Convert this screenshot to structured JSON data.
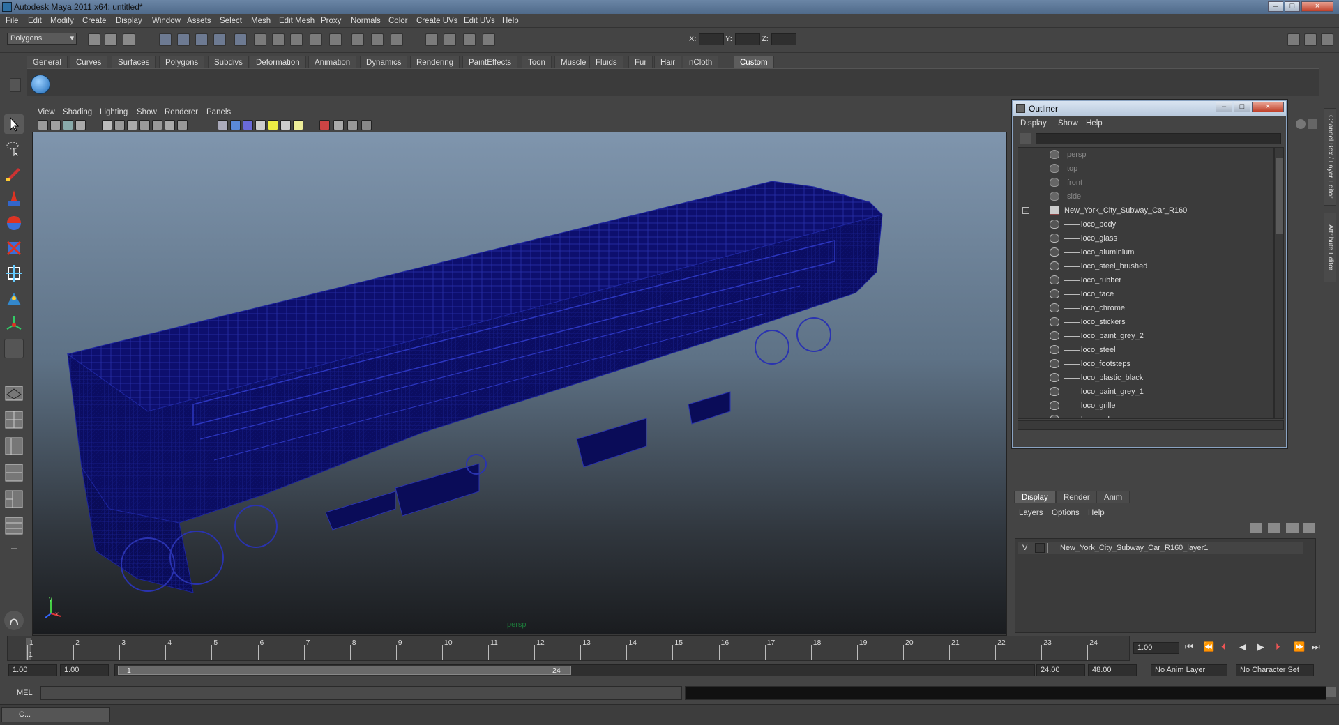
{
  "window": {
    "title": "Autodesk Maya 2011 x64: untitled*",
    "min": "–",
    "max": "□",
    "close": "×"
  },
  "menubar": [
    "File",
    "Edit",
    "Modify",
    "Create",
    "Display",
    "Window",
    "Assets",
    "Select",
    "Mesh",
    "Edit Mesh",
    "Proxy",
    "Normals",
    "Color",
    "Create UVs",
    "Edit UVs",
    "Help"
  ],
  "status": {
    "mode": "Polygons",
    "x_label": "X:",
    "y_label": "Y:",
    "z_label": "Z:"
  },
  "shelf_tabs": [
    "General",
    "Curves",
    "Surfaces",
    "Polygons",
    "Subdivs",
    "Deformation",
    "Animation",
    "Dynamics",
    "Rendering",
    "PaintEffects",
    "Toon",
    "Muscle",
    "Fluids",
    "Fur",
    "Hair",
    "nCloth",
    "Custom"
  ],
  "shelf_active": "Custom",
  "viewport": {
    "menu": [
      "View",
      "Shading",
      "Lighting",
      "Show",
      "Renderer",
      "Panels"
    ],
    "camera_label": "persp",
    "axis_x": "x",
    "axis_y": "y"
  },
  "outliner": {
    "title": "Outliner",
    "menu": [
      "Display",
      "Show",
      "Help"
    ],
    "cameras": [
      "persp",
      "top",
      "front",
      "side"
    ],
    "group": "New_York_City_Subway_Car_R160",
    "children": [
      "loco_body",
      "loco_glass",
      "loco_aluminium",
      "loco_steel_brushed",
      "loco_rubber",
      "loco_face",
      "loco_chrome",
      "loco_stickers",
      "loco_paint_grey_2",
      "loco_steel",
      "loco_footsteps",
      "loco_plastic_black",
      "loco_paint_grey_1",
      "loco_grille",
      "loco_hole"
    ]
  },
  "side_tabs": [
    "Channel Box / Layer Editor",
    "Attribute Editor"
  ],
  "layer_editor": {
    "tabs": [
      "Display",
      "Render",
      "Anim"
    ],
    "active_tab": "Display",
    "menu": [
      "Layers",
      "Options",
      "Help"
    ],
    "layer_visibility": "V",
    "layer_name": "New_York_City_Subway_Car_R160_layer1"
  },
  "timeline": {
    "frames": [
      "1",
      "2",
      "3",
      "4",
      "5",
      "6",
      "7",
      "8",
      "9",
      "10",
      "11",
      "12",
      "13",
      "14",
      "15",
      "16",
      "17",
      "18",
      "19",
      "20",
      "21",
      "22",
      "23",
      "24"
    ],
    "current_frame": "1",
    "current_time": "1.00"
  },
  "range": {
    "start": "1.00",
    "anim_start": "1.00",
    "range_start_label": "1",
    "range_end_label": "24",
    "anim_end": "24.00",
    "end": "48.00",
    "anim_layer": "No Anim Layer",
    "char_set": "No Character Set"
  },
  "cmd": {
    "label": "MEL"
  },
  "taskbar": {
    "item": "C..."
  },
  "colors": {
    "wire": "#0d0f6e",
    "bg_top": "#7f95ad",
    "bg_bottom": "#1a1c1f",
    "panel": "#444444"
  }
}
